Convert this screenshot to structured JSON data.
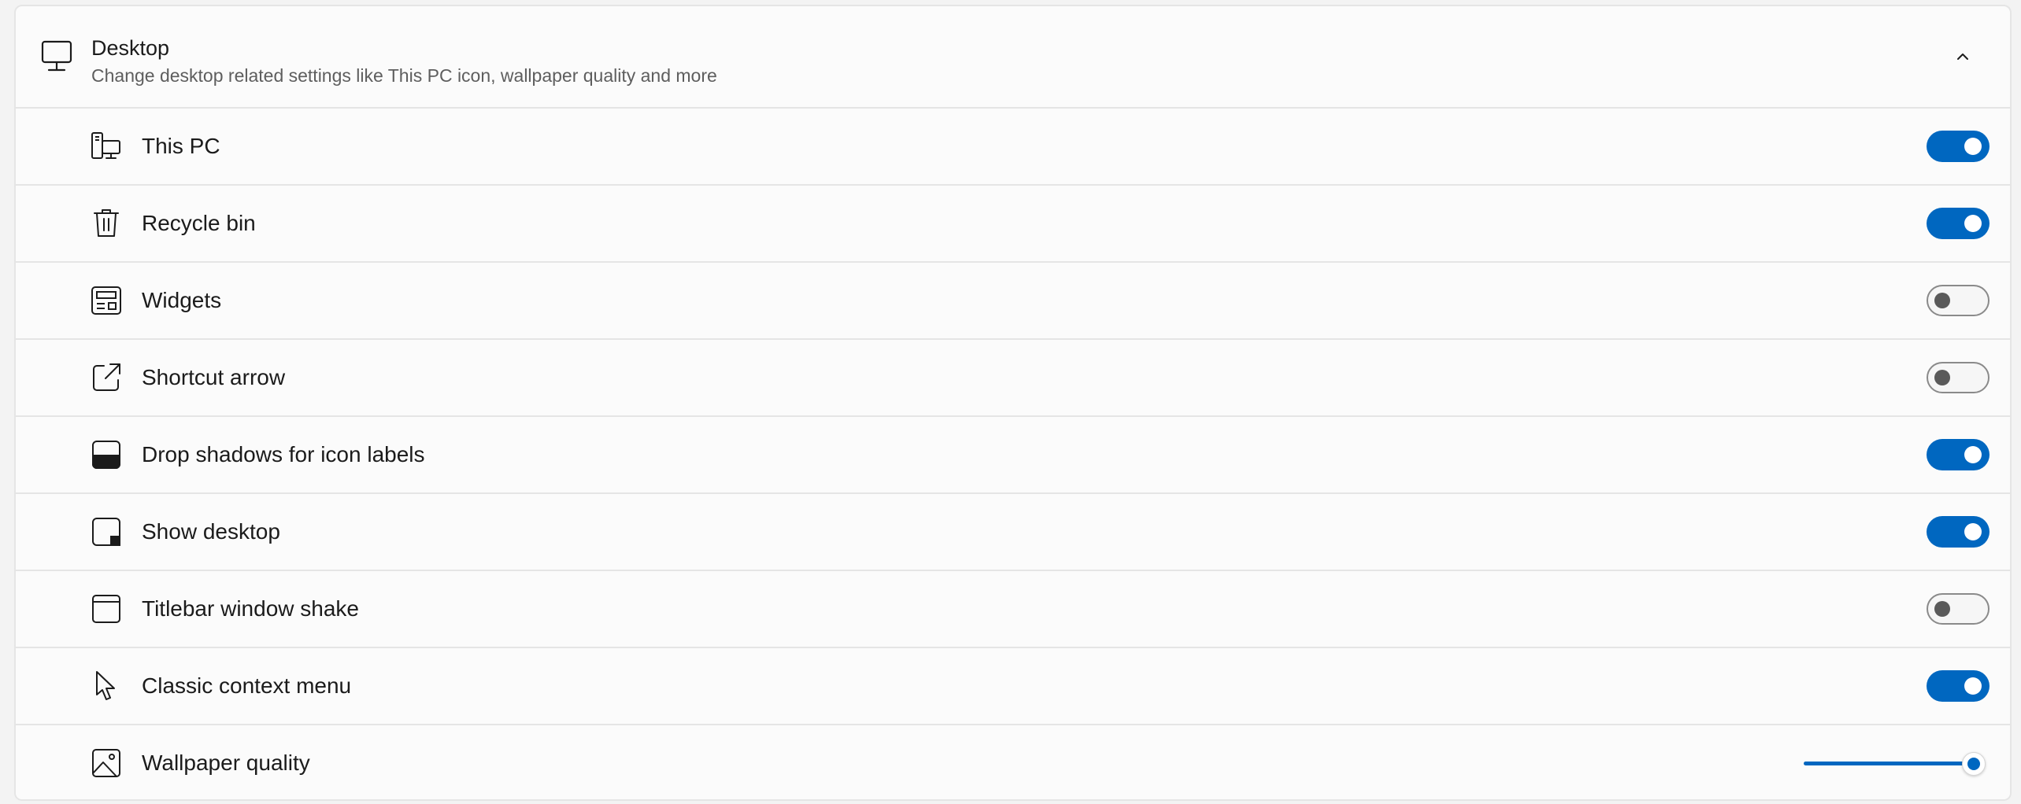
{
  "header": {
    "title": "Desktop",
    "subtitle": "Change desktop related settings like This PC icon, wallpaper quality and more",
    "icon": "monitor-icon",
    "expanded": true
  },
  "colors": {
    "accent": "#0067c0",
    "toggle_off_border": "#8a8a8a",
    "divider": "#e5e5e5"
  },
  "rows": [
    {
      "label": "This PC",
      "icon": "this-pc-icon",
      "control": "toggle",
      "on": true
    },
    {
      "label": "Recycle bin",
      "icon": "recycle-bin-icon",
      "control": "toggle",
      "on": true
    },
    {
      "label": "Widgets",
      "icon": "widgets-icon",
      "control": "toggle",
      "on": false
    },
    {
      "label": "Shortcut arrow",
      "icon": "shortcut-arrow-icon",
      "control": "toggle",
      "on": false
    },
    {
      "label": "Drop shadows for icon labels",
      "icon": "drop-shadow-icon",
      "control": "toggle",
      "on": true
    },
    {
      "label": "Show desktop",
      "icon": "show-desktop-icon",
      "control": "toggle",
      "on": true
    },
    {
      "label": "Titlebar window shake",
      "icon": "titlebar-window-icon",
      "control": "toggle",
      "on": false
    },
    {
      "label": "Classic context menu",
      "icon": "cursor-icon",
      "control": "toggle",
      "on": true
    },
    {
      "label": "Wallpaper quality",
      "icon": "image-icon",
      "control": "slider",
      "value": 1.0
    }
  ]
}
